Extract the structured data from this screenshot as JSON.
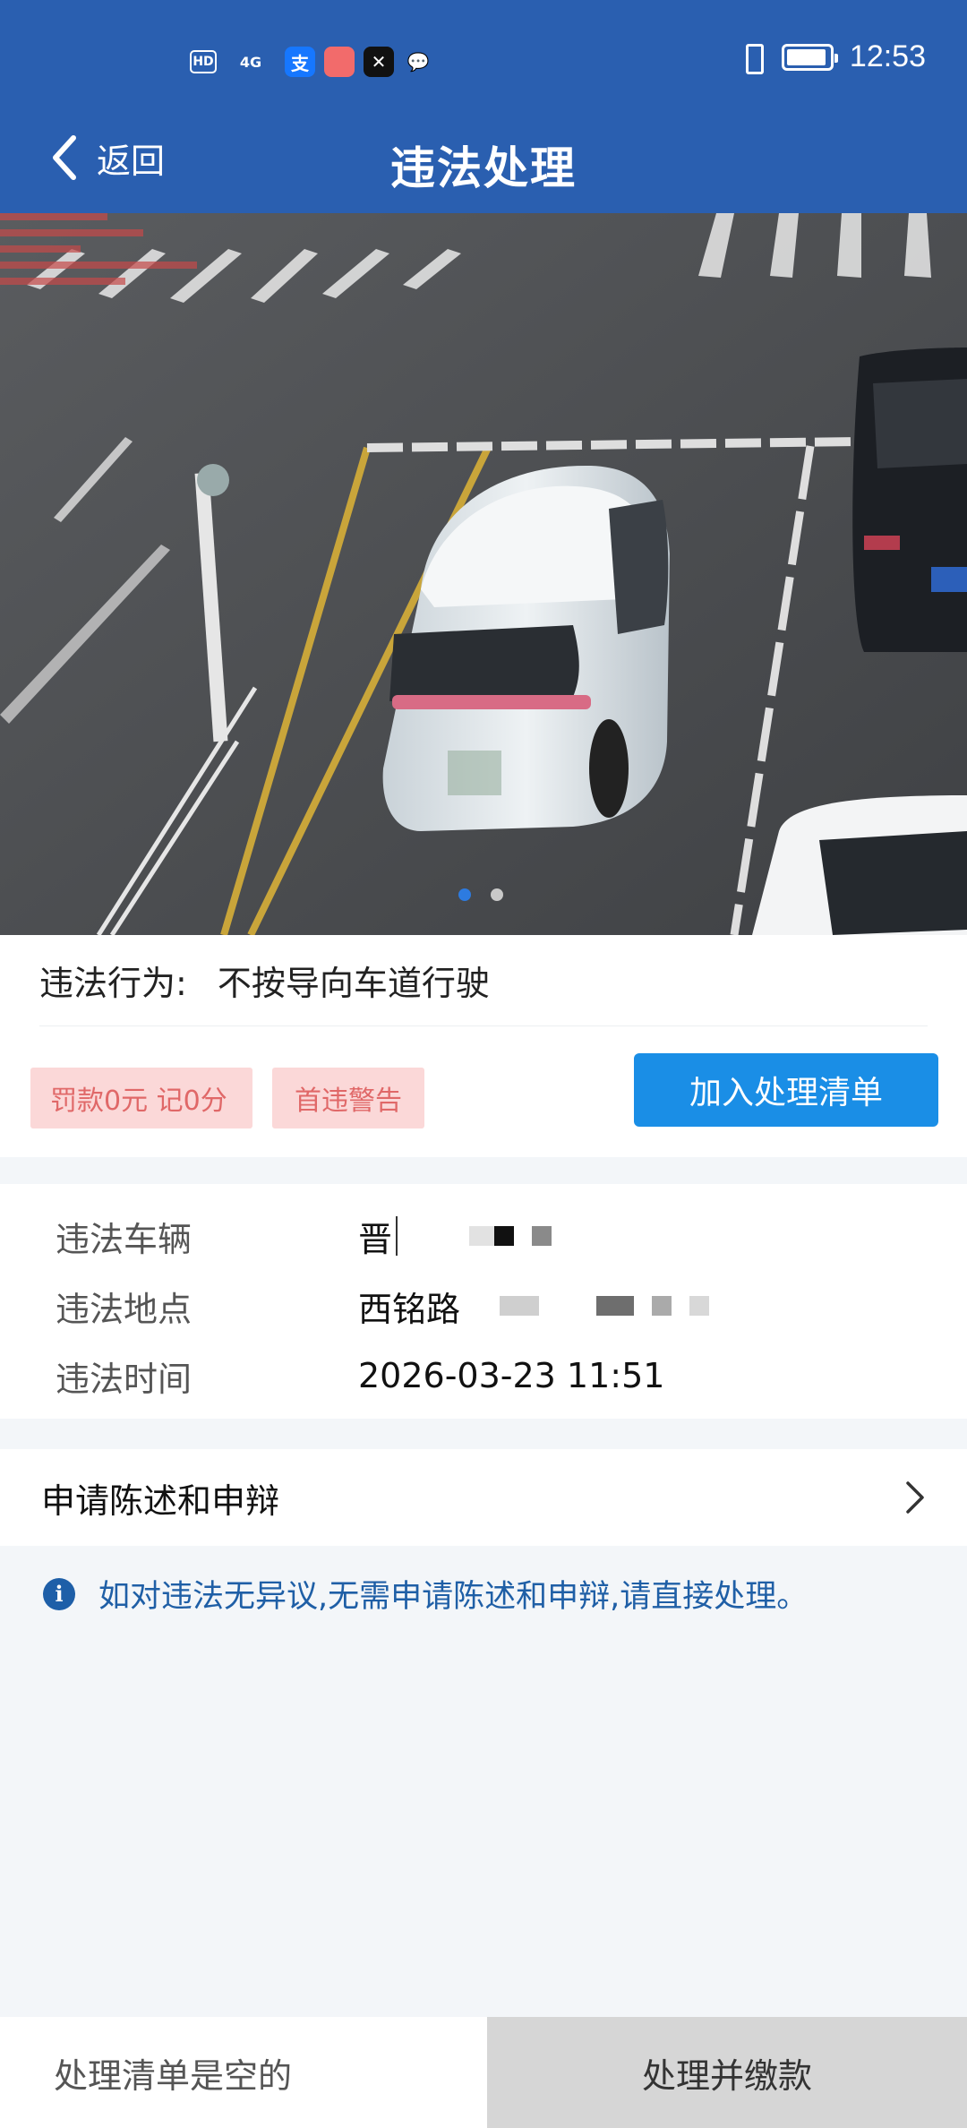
{
  "status_bar": {
    "left_icons": [
      "HD",
      "4G",
      "alipay-app-icon",
      "red-app-icon",
      "capcut-app-icon",
      "message-app-icon"
    ],
    "time": "12:53"
  },
  "header": {
    "back_label": "返回",
    "title": "违法处理"
  },
  "photo": {
    "page_count": 2,
    "active_page": 1
  },
  "violation": {
    "behavior_label": "违法行为:",
    "behavior_value": "不按导向车道行驶",
    "fine_tag": "罚款0元 记0分",
    "first_offense_tag": "首违警告",
    "add_button": "加入处理清单"
  },
  "details": {
    "vehicle_label": "违法车辆",
    "vehicle_value": "晋",
    "location_label": "违法地点",
    "location_value": "西铭路",
    "time_label": "违法时间",
    "time_value": "2026-03-23 11:51"
  },
  "statement": {
    "label": "申请陈述和申辩"
  },
  "info": {
    "text": "如对违法无异议,无需申请陈述和申辩,请直接处理。"
  },
  "bottom": {
    "cart_status": "处理清单是空的",
    "pay_button": "处理并缴款"
  },
  "colors": {
    "header_bg": "#2a5fb0",
    "primary_button": "#1a8ee6",
    "tag_bg": "#fbd8d8",
    "tag_text": "#e06868",
    "info_text": "#1f5fa6"
  }
}
